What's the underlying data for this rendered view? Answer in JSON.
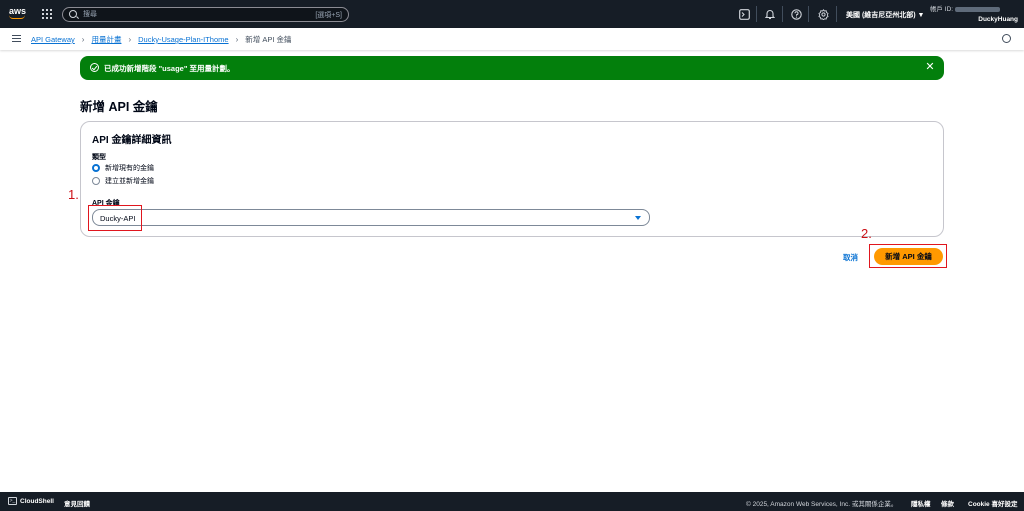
{
  "topnav": {
    "search_placeholder": "搜尋",
    "search_shortcut": "[選項+S]",
    "region": "美國 (維吉尼亞州北部) ▼",
    "account_label": "帳戶 ID:",
    "username": "DuckyHuang",
    "logo_text": "aws"
  },
  "breadcrumbs": {
    "items": [
      "API Gateway",
      "用量計畫",
      "Ducky-Usage-Plan-IThome"
    ],
    "current": "新增 API 金鑰"
  },
  "flash": {
    "message": "已成功新增階段 \"usage\" 至用量計劃。",
    "type": "success"
  },
  "page": {
    "title": "新增 API 金鑰"
  },
  "details": {
    "title": "API 金鑰詳細資訊",
    "type_label": "類型",
    "options": [
      "新增現有的金鑰",
      "建立並新增金鑰"
    ],
    "selected_option": "新增現有的金鑰",
    "key_label": "API 金鑰",
    "key_value": "Ducky-API"
  },
  "annotations": {
    "one": "1.",
    "two": "2."
  },
  "actions": {
    "cancel": "取消",
    "submit": "新增 API 金鑰"
  },
  "footer": {
    "cloudshell": "CloudShell",
    "feedback": "意見回饋",
    "copyright": "© 2025, Amazon Web Services, Inc. 或其關係企業。",
    "privacy": "隱私權",
    "terms": "條款",
    "cookie": "Cookie 喜好設定"
  },
  "colors": {
    "nav_bg": "#161d26",
    "link": "#0972d3",
    "success": "#037f0c",
    "primary_button": "#ff9900",
    "annotation": "#e0161e"
  }
}
